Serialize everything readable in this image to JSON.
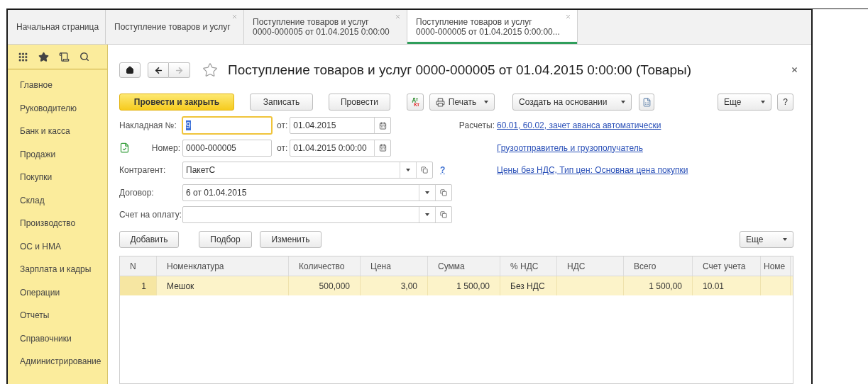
{
  "tabs": [
    {
      "lines": [
        "Начальная страница"
      ],
      "closable": false,
      "selected": false
    },
    {
      "lines": [
        "Поступление товаров и услуг"
      ],
      "closable": true,
      "selected": false
    },
    {
      "lines": [
        "Поступление товаров и услуг",
        "0000-000005 от 01.04.2015 0:00:00"
      ],
      "closable": true,
      "selected": false
    },
    {
      "lines": [
        "Поступление товаров и услуг",
        "0000-000005 от 01.04.2015 0:00:00..."
      ],
      "closable": true,
      "selected": true
    }
  ],
  "sidebar": {
    "items": [
      "Главное",
      "Руководителю",
      "Банк и касса",
      "Продажи",
      "Покупки",
      "Склад",
      "Производство",
      "ОС и НМА",
      "Зарплата и кадры",
      "Операции",
      "Отчеты",
      "Справочники",
      "Администрирование"
    ]
  },
  "document": {
    "title": "Поступление товаров и услуг 0000-000005 от 01.04.2015 0:00:00 (Товары)",
    "favorite": false,
    "back_disabled": false,
    "forward_disabled": true
  },
  "commands": [
    {
      "kind": "primary",
      "label": "Провести и закрыть"
    },
    {
      "kind": "plain",
      "label": "Записать"
    },
    {
      "kind": "plain",
      "label": "Провести"
    },
    {
      "kind": "dtkt",
      "top": "Дт",
      "bottom": "Кт"
    },
    {
      "kind": "print",
      "label": "Печать"
    },
    {
      "kind": "menu",
      "label": "Создать на основании"
    },
    {
      "kind": "doc"
    },
    {
      "kind": "menu",
      "label": "Еще"
    },
    {
      "kind": "plain",
      "label": "?"
    }
  ],
  "number_rows": [
    {
      "label": "Накладная №:",
      "value": "9",
      "focused": true,
      "date_label": "от:",
      "date": "01.04.2015"
    },
    {
      "label": "Номер:",
      "value": "0000-000005",
      "focused": false,
      "date_label": "от:",
      "date": "01.04.2015  0:00:00"
    }
  ],
  "document_status": {
    "posted": true
  },
  "select_fields": [
    {
      "label": "Контрагент:",
      "value": "ПакетС",
      "help": "?"
    },
    {
      "label": "Договор:",
      "value": "6 от 01.04.2015"
    },
    {
      "label": "Счет на оплату:"
    }
  ],
  "side_links": [
    {
      "label": "Расчеты:",
      "link": "60.01, 60.02, зачет аванса автоматически"
    },
    {
      "link": "Грузоотправитель и грузополучатель"
    },
    {
      "link": "Цены без НДС, Тип цен: Основная цена покупки"
    }
  ],
  "table": {
    "buttons": [
      "Добавить",
      "Подбор",
      "Изменить"
    ],
    "more": "Еще",
    "columns": [
      {
        "title": "N",
        "kind": "number"
      },
      {
        "title": "Номенклатура",
        "kind": "text"
      },
      {
        "title": "Количество",
        "kind": "number"
      },
      {
        "title": "Цена",
        "kind": "number"
      },
      {
        "title": "Сумма",
        "kind": "number"
      },
      {
        "title": "% НДС",
        "kind": "text"
      },
      {
        "title": "НДС",
        "kind": "number"
      },
      {
        "title": "Всего",
        "kind": "number"
      },
      {
        "title": "Счет учета",
        "kind": "text"
      },
      {
        "title": "Номе",
        "kind": "text"
      }
    ],
    "rows": [
      {
        "selected": true,
        "cells": [
          "1",
          "Мешок",
          "500,000",
          "3,00",
          "1 500,00",
          "Без НДС",
          "",
          "1 500,00",
          "10.01",
          ""
        ]
      }
    ]
  }
}
